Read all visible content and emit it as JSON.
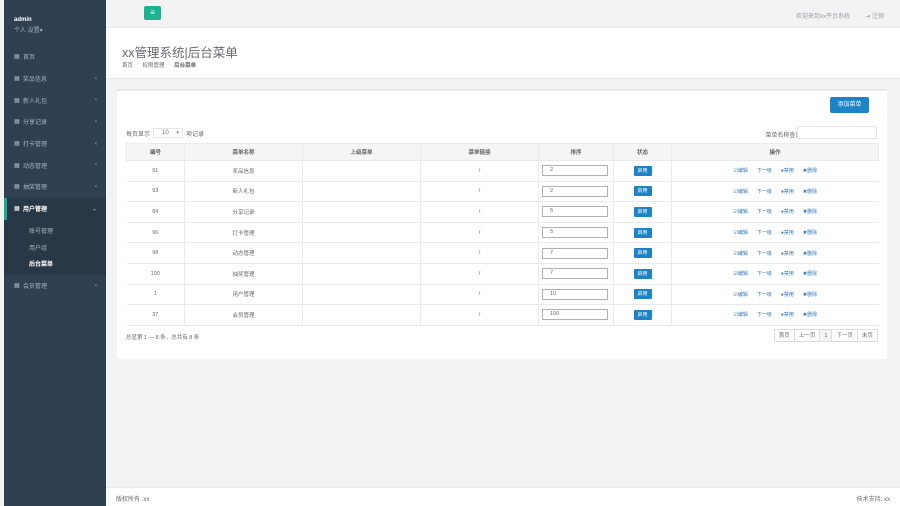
{
  "sidebar": {
    "user": "admin",
    "profile_menu": "个人 设置▾",
    "items": [
      {
        "label": "首页",
        "has_children": false
      },
      {
        "label": "奖品信息",
        "has_children": true
      },
      {
        "label": "新人礼包",
        "has_children": true
      },
      {
        "label": "分享记录",
        "has_children": true
      },
      {
        "label": "打卡管理",
        "has_children": true
      },
      {
        "label": "动态管理",
        "has_children": true
      },
      {
        "label": "抽奖管理",
        "has_children": true
      },
      {
        "label": "用户管理",
        "has_children": true,
        "expanded": true
      },
      {
        "label": "会员管理",
        "has_children": true
      }
    ],
    "submenu": [
      "账号管理",
      "用户组",
      "后台菜单"
    ]
  },
  "topbar": {
    "menu_icon": "≡",
    "welcome": "欢迎来到xx平台系统",
    "logout": "注销"
  },
  "heading": {
    "title": "xx管理系统|后台菜单",
    "breadcrumb": [
      "首页",
      "权限管理",
      "后台菜单"
    ]
  },
  "toolbar": {
    "add_button": "添加菜单",
    "page_size_prefix": "每页显示",
    "page_size_value": "10",
    "page_size_suffix": "项记录",
    "search_label": "菜单名称查询:"
  },
  "table": {
    "columns": [
      "编号",
      "菜单名称",
      "上级菜单",
      "菜单链接",
      "排序",
      "状态",
      "操作"
    ],
    "rows": [
      {
        "id": "91",
        "name": "奖品信息",
        "parent": "",
        "link": "/",
        "sort": "2",
        "state": "启用"
      },
      {
        "id": "93",
        "name": "新人礼包",
        "parent": "",
        "link": "/",
        "sort": "2",
        "state": "启用"
      },
      {
        "id": "84",
        "name": "分享记录",
        "parent": "",
        "link": "/",
        "sort": "5",
        "state": "启用"
      },
      {
        "id": "96",
        "name": "打卡管理",
        "parent": "",
        "link": "/",
        "sort": "5",
        "state": "启用"
      },
      {
        "id": "98",
        "name": "动态管理",
        "parent": "",
        "link": "/",
        "sort": "7",
        "state": "启用"
      },
      {
        "id": "100",
        "name": "抽奖管理",
        "parent": "",
        "link": "/",
        "sort": "7",
        "state": "启用"
      },
      {
        "id": "1",
        "name": "用户管理",
        "parent": "",
        "link": "/",
        "sort": "10",
        "state": "启用"
      },
      {
        "id": "37",
        "name": "会员管理",
        "parent": "",
        "link": "/",
        "sort": "100",
        "state": "启用"
      }
    ],
    "ops": [
      "☑编辑",
      "下一级",
      "●禁用",
      "✖删除"
    ]
  },
  "pagination": {
    "info": "总显第 1 — 8 条，总共有 8 条",
    "buttons": [
      "首页",
      "上一页",
      "1",
      "下一页",
      "末页"
    ]
  },
  "footer": {
    "copyright": "版权所有 :xx",
    "support": "技术支持: xx"
  },
  "colors": {
    "sidebar_bg": "#2f4050",
    "accent_green": "#1ab394",
    "primary_blue": "#1c84c6"
  }
}
